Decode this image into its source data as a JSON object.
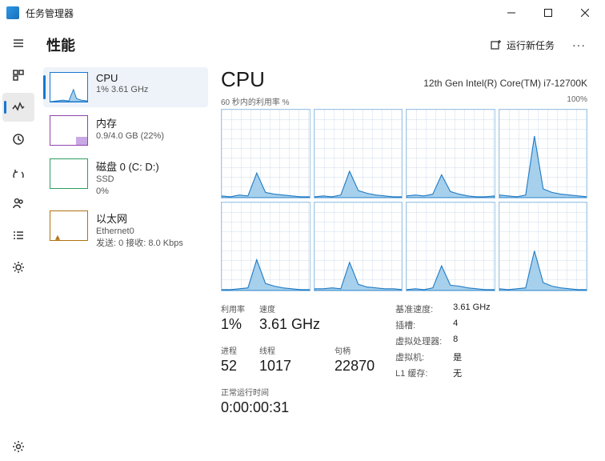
{
  "app": {
    "title": "任务管理器"
  },
  "header": {
    "title": "性能",
    "run_task": "运行新任务",
    "more": "···"
  },
  "sidelist": [
    {
      "id": "cpu",
      "title": "CPU",
      "sub": "1% 3.61 GHz"
    },
    {
      "id": "mem",
      "title": "内存",
      "sub": "0.9/4.0 GB (22%)"
    },
    {
      "id": "disk",
      "title": "磁盘 0 (C: D:)",
      "sub": "SSD\n0%"
    },
    {
      "id": "net",
      "title": "以太网",
      "sub": "Ethernet0\n发送: 0 接收: 8.0 Kbps"
    }
  ],
  "main": {
    "title": "CPU",
    "model": "12th Gen Intel(R) Core(TM) i7-12700K",
    "chart_label_left": "60 秒内的利用率 %",
    "chart_label_right": "100%"
  },
  "stats": {
    "util_lbl": "利用率",
    "util_val": "1%",
    "speed_lbl": "速度",
    "speed_val": "3.61 GHz",
    "proc_lbl": "进程",
    "proc_val": "52",
    "thread_lbl": "线程",
    "thread_val": "1017",
    "handle_lbl": "句柄",
    "handle_val": "22870"
  },
  "right": {
    "base_k": "基准速度:",
    "base_v": "3.61 GHz",
    "sockets_k": "插槽:",
    "sockets_v": "4",
    "vcpu_k": "虚拟处理器:",
    "vcpu_v": "8",
    "vm_k": "虚拟机:",
    "vm_v": "是",
    "l1_k": "L1 缓存:",
    "l1_v": "无"
  },
  "uptime": {
    "lbl": "正常运行时间",
    "val": "0:00:00:31"
  },
  "chart_data": {
    "type": "line",
    "title": "60 秒内的利用率 %",
    "ylim": [
      0,
      100
    ],
    "cores": [
      [
        2,
        1,
        3,
        2,
        28,
        6,
        4,
        3,
        2,
        1,
        1
      ],
      [
        1,
        2,
        1,
        3,
        30,
        8,
        5,
        3,
        2,
        1,
        1
      ],
      [
        2,
        3,
        2,
        4,
        26,
        7,
        4,
        2,
        1,
        1,
        2
      ],
      [
        3,
        2,
        1,
        3,
        70,
        10,
        6,
        4,
        3,
        2,
        1
      ],
      [
        1,
        1,
        2,
        3,
        35,
        8,
        5,
        3,
        2,
        1,
        1
      ],
      [
        2,
        2,
        3,
        2,
        32,
        7,
        4,
        3,
        2,
        2,
        1
      ],
      [
        1,
        2,
        1,
        3,
        28,
        6,
        5,
        3,
        2,
        1,
        1
      ],
      [
        2,
        1,
        2,
        3,
        45,
        9,
        5,
        3,
        2,
        1,
        1
      ]
    ]
  }
}
